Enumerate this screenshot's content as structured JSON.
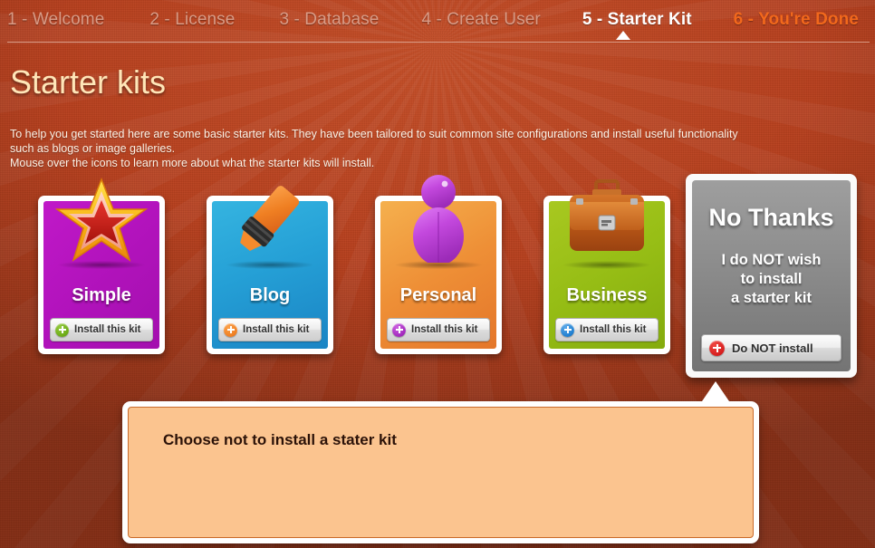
{
  "header": {
    "tabs": [
      {
        "label": "1 - Welcome",
        "state": "inactive"
      },
      {
        "label": "2 - License",
        "state": "inactive"
      },
      {
        "label": "3 - Database",
        "state": "inactive"
      },
      {
        "label": "4 - Create User",
        "state": "inactive"
      },
      {
        "label": "5 - Starter Kit",
        "state": "active"
      },
      {
        "label": "6 - You're Done",
        "state": "last"
      }
    ],
    "active_index": 4
  },
  "page": {
    "title": "Starter kits",
    "intro_line_1": "To help you get started here are some basic starter kits. They have been tailored to suit common site configurations and install useful functionality",
    "intro_line_2": "such as blogs or image galleries.",
    "intro_line_3": "Mouse over the icons to learn more about what the starter kits will install."
  },
  "kits": [
    {
      "name": "Simple",
      "icon": "star-icon",
      "button_label": "Install this kit",
      "button_icon": "plus-circle-icon",
      "accent": "#6cab17",
      "card_color": "#b313bd"
    },
    {
      "name": "Blog",
      "icon": "marker-pen-icon",
      "button_label": "Install this kit",
      "button_icon": "plus-circle-icon",
      "accent": "#ef7f22",
      "card_color": "#25a0d6"
    },
    {
      "name": "Personal",
      "icon": "person-icon",
      "button_label": "Install this kit",
      "button_icon": "plus-circle-icon",
      "accent": "#a229bd",
      "card_color": "#ee8f36"
    },
    {
      "name": "Business",
      "icon": "briefcase-icon",
      "button_label": "Install this kit",
      "button_icon": "plus-circle-icon",
      "accent": "#1f7fd0",
      "card_color": "#96bd15"
    }
  ],
  "no_thanks": {
    "title": "No Thanks",
    "subtitle_line_1": "I do NOT wish",
    "subtitle_line_2": "to install",
    "subtitle_line_3": "a starter kit",
    "button_label": "Do NOT install",
    "button_icon": "plus-circle-icon",
    "accent": "#d61f1f"
  },
  "tooltip": {
    "text": "Choose not to install a stater kit"
  },
  "colors": {
    "background": "#b8401e",
    "title": "#ffe6b8",
    "active_tab": "#ffffff",
    "inactive_tab": "#d99b86",
    "last_tab": "#f2681c",
    "tooltip_bg": "#fbc48f",
    "tooltip_border": "#c96a2a"
  }
}
